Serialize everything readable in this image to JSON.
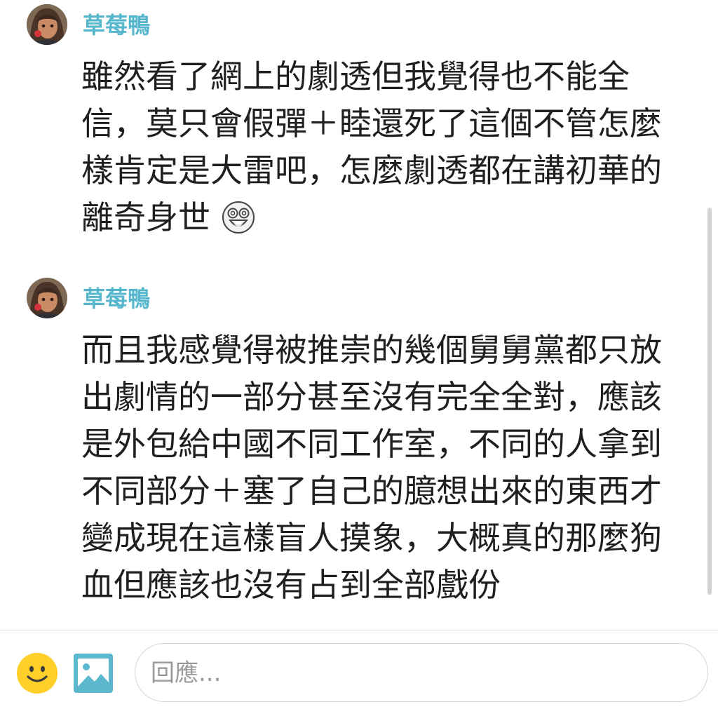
{
  "colors": {
    "author": "#55b6cc",
    "text": "#1f1f1f",
    "placeholder": "#9a9a9a",
    "emoji_button": "#ffd02a",
    "image_button": "#5bb8ce"
  },
  "comments": [
    {
      "author": "草莓鴨",
      "avatar_icon": "avatar-girl-icon",
      "text": "雖然看了網上的劇透但我覺得也不能全信，莫只會假彈＋睦還死了這個不管怎麼樣肯定是大雷吧，怎麼劇透都在講初華的離奇身世",
      "emoji": "shocked-face-icon"
    },
    {
      "author": "草莓鴨",
      "avatar_icon": "avatar-girl-icon",
      "text": "而且我感覺得被推崇的幾個舅舅黨都只放出劇情的一部分甚至沒有完全全對，應該是外包給中國不同工作室，不同的人拿到不同部分＋塞了自己的臆想出來的東西才變成現在這樣盲人摸象，大概真的那麼狗血但應該也沒有占到全部戲份"
    }
  ],
  "reply_bar": {
    "emoji_icon": "smiley-icon",
    "image_icon": "image-icon",
    "placeholder": "回應..."
  }
}
